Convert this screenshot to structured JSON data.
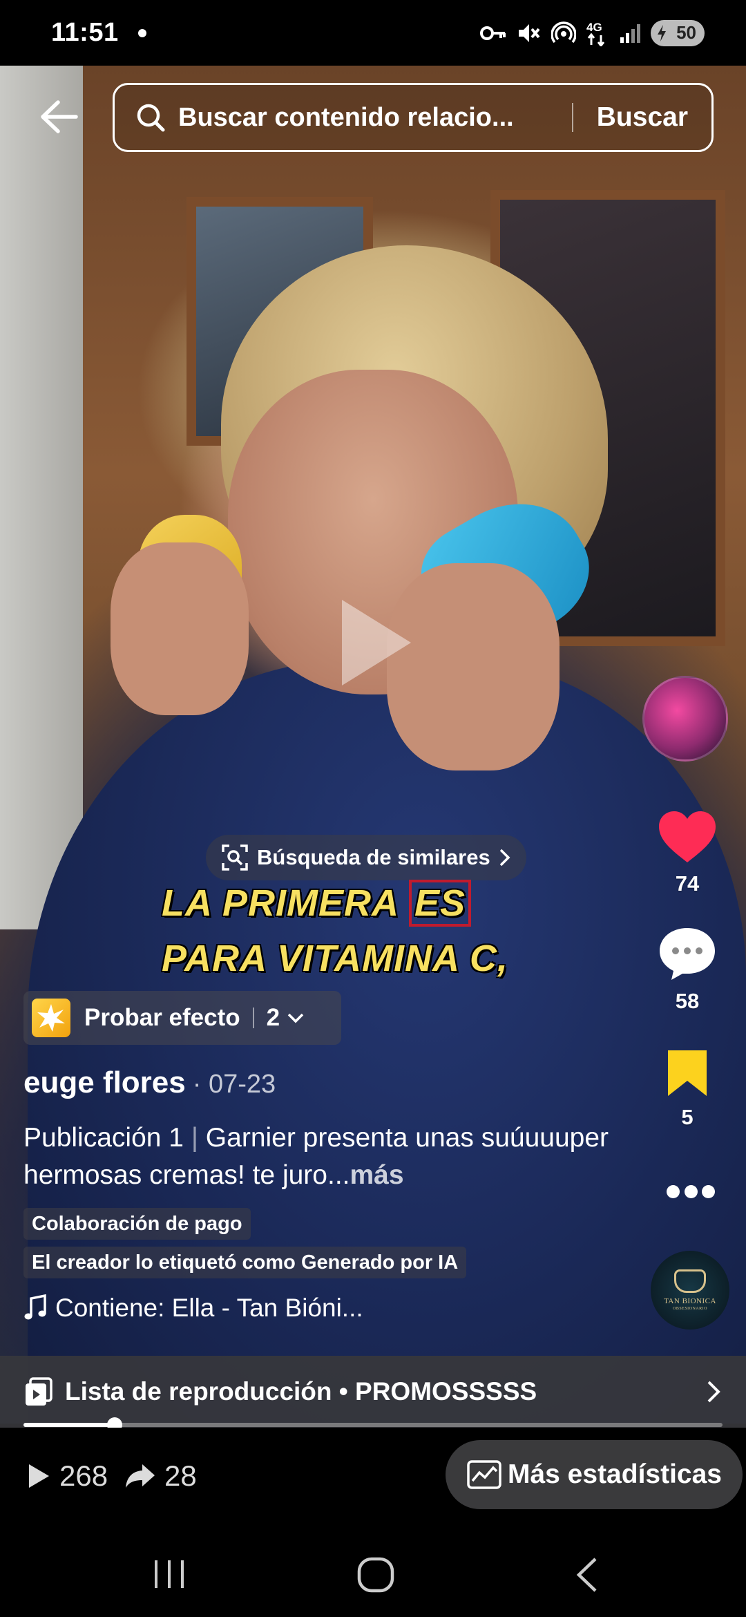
{
  "status_bar": {
    "time": "11:51",
    "network": "4G",
    "battery": "50"
  },
  "search": {
    "placeholder": "Buscar contenido relacio...",
    "button_label": "Buscar"
  },
  "caption_overlay": {
    "line1_pre": "LA PRIMERA ",
    "line1_boxed": "ES",
    "line2": "PARA VITAMINA C,"
  },
  "similar_search": {
    "label": "Búsqueda de similares"
  },
  "actions": {
    "likes": "74",
    "comments": "58",
    "saves": "5",
    "like_color": "#fe2c55",
    "save_color": "#fcd21e"
  },
  "effect": {
    "label": "Probar efecto",
    "count": "2"
  },
  "post": {
    "author": "euge flores",
    "date": "· 07-23",
    "desc_prefix": "Publicación 1",
    "desc_pipe": "|",
    "desc_text": " Garnier presenta unas suúuuuper hermosas cremas! te juro...",
    "more_label": "más",
    "tag_paid": "Colaboración de pago",
    "tag_ai": "El creador lo etiquetó como Generado por IA",
    "music": "Contiene: Ella - Tan Bióni..."
  },
  "music_disc": {
    "text": "TAN BIONICA",
    "subtext": "OBSESIONARIO"
  },
  "playlist": {
    "label": "Lista de reproducción • PROMOSSSSS"
  },
  "progress": {
    "fraction": 0.13
  },
  "stats": {
    "plays": "268",
    "shares": "28",
    "more_stats_label": "Más estadísticas"
  },
  "icons": {
    "back": "back-arrow-icon",
    "search": "search-icon",
    "play": "play-icon",
    "heart": "heart-icon",
    "comment": "comment-icon",
    "bookmark": "bookmark-icon",
    "more": "more-icon",
    "music": "music-note-icon",
    "playlist": "playlist-icon",
    "chevron": "chevron-right-icon",
    "stats": "chart-icon",
    "share": "share-arrow-icon"
  }
}
